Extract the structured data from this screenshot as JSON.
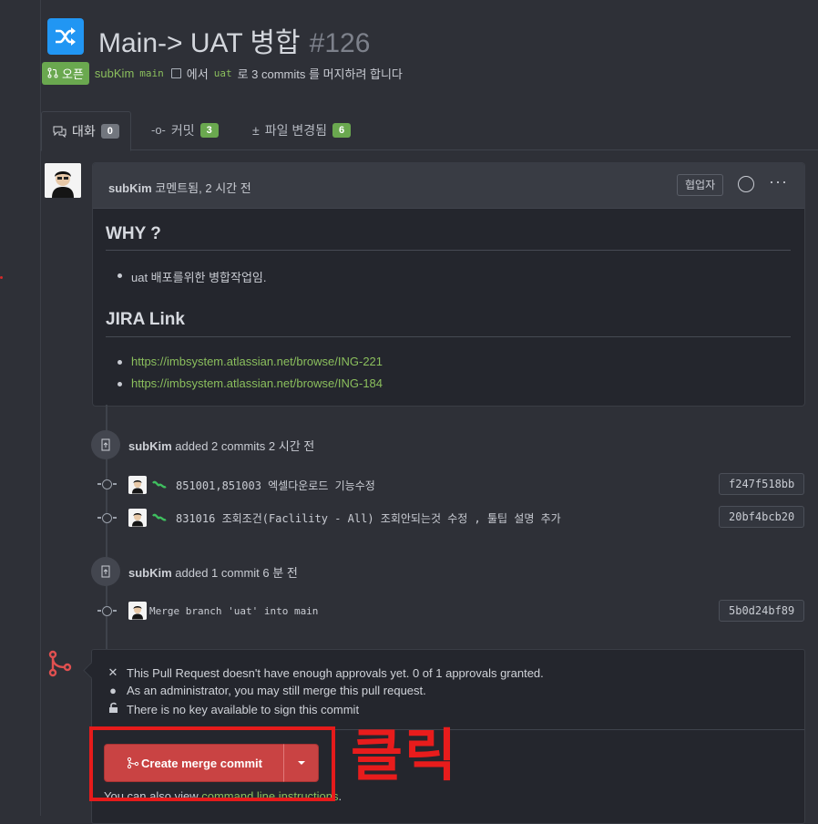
{
  "header": {
    "title": "Main-> UAT 병합",
    "number": "#126",
    "status_badge": "오픈",
    "author": "subKim",
    "source_branch": "main",
    "text_from": "에서",
    "target_branch": "uat",
    "text_to": "로 3 commits 를 머지하려 합니다"
  },
  "tabs": [
    {
      "label": "대화",
      "count": "0"
    },
    {
      "label": "커밋",
      "count": "3"
    },
    {
      "label": "파일 변경됨",
      "count": "6"
    }
  ],
  "comment": {
    "author": "subKim",
    "meta": "코멘트됨, 2 시간 전",
    "role_badge": "협업자",
    "heading1": "WHY ?",
    "bullet1": "uat 배포를위한 병합작업임.",
    "heading2": "JIRA Link",
    "links": [
      "https://imbsystem.atlassian.net/browse/ING-221",
      "https://imbsystem.atlassian.net/browse/ING-184"
    ]
  },
  "timeline": {
    "event1": {
      "author": "subKim",
      "text": "added 2 commits 2 시간 전"
    },
    "commits1": [
      {
        "message": "851001,851003 엑셀다운로드 기능수정",
        "sha": "f247f518bb"
      },
      {
        "message": "831016 조회조건(Faclility - All) 조회안되는것 수정 , 툴팁 설명 추가",
        "sha": "20bf4bcb20"
      }
    ],
    "event2": {
      "author": "subKim",
      "text": "added 1 commit 6 분 전"
    },
    "commits2": [
      {
        "message": "Merge branch 'uat' into main",
        "sha": "5b0d24bf89"
      }
    ]
  },
  "merge": {
    "line1": "This Pull Request doesn't have enough approvals yet. 0 of 1 approvals granted.",
    "line2": "As an administrator, you may still merge this pull request.",
    "line3": "There is no key available to sign this commit",
    "button": "Create merge commit",
    "also_prefix": "You can also view",
    "also_link": "command line instructions",
    "also_suffix": "."
  },
  "annotation": {
    "label": "클릭",
    "color": "#e61b1b"
  },
  "colors": {
    "background": "#2e3037",
    "accent_green": "#6aa84f",
    "merge_red": "#c94343",
    "repo_icon_blue": "#2196f3"
  }
}
